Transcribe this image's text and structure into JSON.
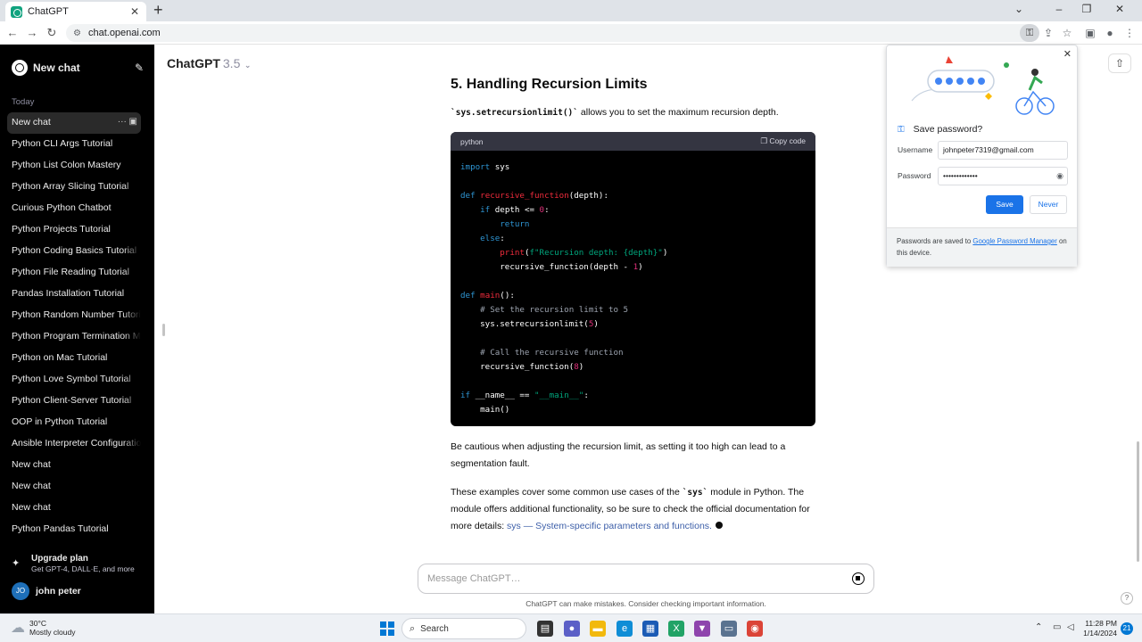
{
  "browser": {
    "tab_title": "ChatGPT",
    "url": "chat.openai.com"
  },
  "sidebar": {
    "new_chat_label": "New chat",
    "section_today": "Today",
    "items": [
      {
        "label": "New chat",
        "active": true
      },
      {
        "label": "Python CLI Args Tutorial"
      },
      {
        "label": "Python List Colon Mastery"
      },
      {
        "label": "Python Array Slicing Tutorial"
      },
      {
        "label": "Curious Python Chatbot"
      },
      {
        "label": "Python Projects Tutorial"
      },
      {
        "label": "Python Coding Basics Tutorial"
      },
      {
        "label": "Python File Reading Tutorial"
      },
      {
        "label": "Pandas Installation Tutorial"
      },
      {
        "label": "Python Random Number Tutorial"
      },
      {
        "label": "Python Program Termination Met"
      },
      {
        "label": "Python on Mac Tutorial"
      },
      {
        "label": "Python Love Symbol Tutorial"
      },
      {
        "label": "Python Client-Server Tutorial"
      },
      {
        "label": "OOP in Python Tutorial"
      },
      {
        "label": "Ansible Interpreter Configuration"
      },
      {
        "label": "New chat"
      },
      {
        "label": "New chat"
      },
      {
        "label": "New chat"
      },
      {
        "label": "Python Pandas Tutorial"
      }
    ],
    "upgrade_title": "Upgrade plan",
    "upgrade_subtitle": "Get GPT-4, DALL·E, and more",
    "user_initials": "JO",
    "user_name": "john peter"
  },
  "header": {
    "model_name": "ChatGPT",
    "model_version": "3.5"
  },
  "content": {
    "heading": "5. Handling Recursion Limits",
    "intro_code": "`sys.setrecursionlimit()`",
    "intro_text": " allows you to set the maximum recursion depth.",
    "code_lang": "python",
    "copy_label": "Copy code",
    "caution": "Be cautious when adjusting the recursion limit, as setting it too high can lead to a segmentation fault.",
    "closing_pre": "These examples cover some common use cases of the ",
    "closing_code": "`sys`",
    "closing_mid": " module in Python. The module offers additional functionality, so be sure to check the official documentation for more details: ",
    "closing_link": "sys — System-specific parameters and functions.",
    "code_lines": [
      "import sys",
      "",
      "def recursive_function(depth):",
      "    if depth <= 0:",
      "        return",
      "    else:",
      "        print(f\"Recursion depth: {depth}\")",
      "        recursive_function(depth - 1)",
      "",
      "def main():",
      "    # Set the recursion limit to 5",
      "    sys.setrecursionlimit(5)",
      "",
      "    # Call the recursive function",
      "    recursive_function(8)",
      "",
      "if __name__ == \"__main__\":",
      "    main()"
    ]
  },
  "composer": {
    "placeholder": "Message ChatGPT…",
    "disclaimer": "ChatGPT can make mistakes. Consider checking important information."
  },
  "password_popup": {
    "title": "Save password?",
    "username_label": "Username",
    "username_value": "johnpeter7319@gmail.com",
    "password_label": "Password",
    "password_value": "•••••••••••••",
    "save_label": "Save",
    "never_label": "Never",
    "footer_pre": "Passwords are saved to ",
    "footer_link": "Google Password Manager",
    "footer_post": " on this device."
  },
  "taskbar": {
    "temperature": "30°C",
    "weather": "Mostly cloudy",
    "search_label": "Search",
    "time": "11:28 PM",
    "date": "1/14/2024",
    "notification_count": "21"
  },
  "colors": {
    "sidebar_bg": "#000000",
    "accent": "#1a73e8",
    "code_keyword": "#2e95d3",
    "code_function": "#f22c3d",
    "code_string": "#00a67d",
    "code_number": "#df3079"
  }
}
